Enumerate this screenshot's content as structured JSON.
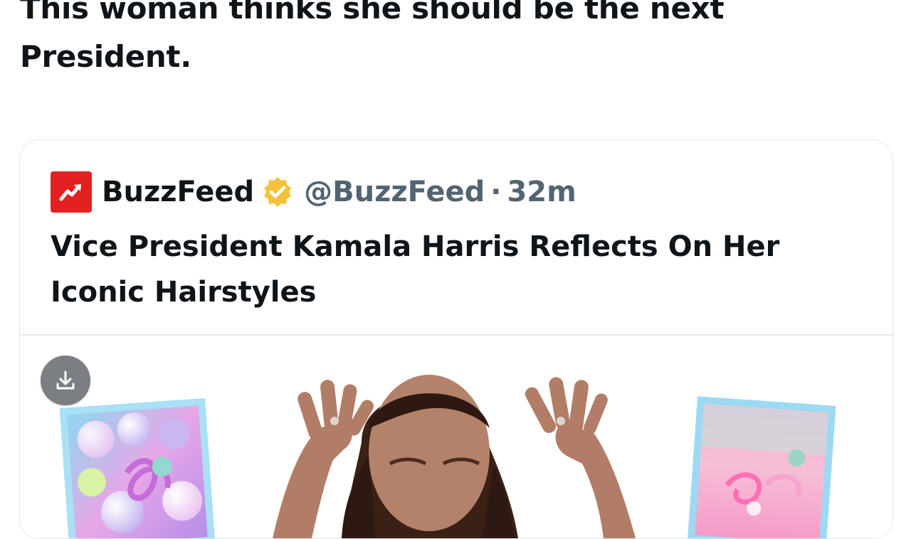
{
  "tweet": {
    "text": "This woman thinks she should be the next President."
  },
  "quoted_tweet": {
    "author_name": "BuzzFeed",
    "handle": "@BuzzFeed",
    "separator": "·",
    "time": "32m",
    "title": "Vice President Kamala Harris Reflects On Her Iconic Hairstyles",
    "logo_color": "#e32020",
    "verified_badge_color": "#f4c23a",
    "icons": {
      "logo": "buzzfeed-trending-arrow-icon",
      "verified": "verified-badge-icon",
      "download": "download-icon"
    }
  }
}
